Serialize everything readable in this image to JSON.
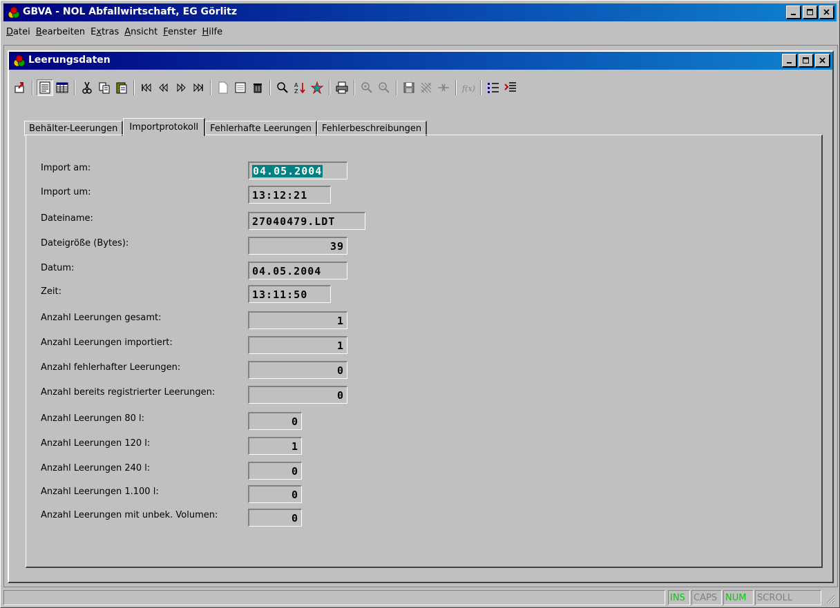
{
  "app": {
    "title": "GBVA - NOL Abfallwirtschaft, EG Görlitz"
  },
  "menu": [
    {
      "pre": "",
      "acc": "D",
      "post": "atei"
    },
    {
      "pre": "",
      "acc": "B",
      "post": "earbeiten"
    },
    {
      "pre": "E",
      "acc": "x",
      "post": "tras"
    },
    {
      "pre": "",
      "acc": "A",
      "post": "nsicht"
    },
    {
      "pre": "",
      "acc": "F",
      "post": "enster"
    },
    {
      "pre": "",
      "acc": "H",
      "post": "ilfe"
    }
  ],
  "child": {
    "title": "Leerungsdaten"
  },
  "tabs": {
    "t0": "Behälter-Leerungen",
    "t1": "Importprotokoll",
    "t2": "Fehlerhafte Leerungen",
    "t3": "Fehlerbeschreibungen"
  },
  "fields": [
    {
      "label": "Import am:",
      "value": "04.05.2004"
    },
    {
      "label": "Import um:",
      "value": "13:12:21"
    },
    {
      "label": "Dateiname:",
      "value": "27040479.LDT"
    },
    {
      "label": "Dateigröße (Bytes):",
      "value": "39"
    },
    {
      "label": "Datum:",
      "value": "04.05.2004"
    },
    {
      "label": "Zeit:",
      "value": "13:11:50"
    },
    {
      "label": "Anzahl Leerungen gesamt:",
      "value": "1"
    },
    {
      "label": "Anzahl Leerungen importiert:",
      "value": "1"
    },
    {
      "label": "Anzahl fehlerhafter Leerungen:",
      "value": "0"
    },
    {
      "label": "Anzahl bereits registrierter Leerungen:",
      "value": "0"
    },
    {
      "label": "Anzahl Leerungen 80 l:",
      "value": "0"
    },
    {
      "label": "Anzahl Leerungen 120 l:",
      "value": "1"
    },
    {
      "label": "Anzahl Leerungen 240 l:",
      "value": "0"
    },
    {
      "label": "Anzahl Leerungen 1.100 l:",
      "value": "0"
    },
    {
      "label": "Anzahl Leerungen mit unbek. Volumen:",
      "value": "0"
    }
  ],
  "status": {
    "ins": "INS",
    "caps": "CAPS",
    "num": "NUM",
    "scroll": "SCROLL"
  },
  "colors": {
    "titlebar": "#000080",
    "selection": "#008080",
    "indicator_on": "#00d000"
  }
}
